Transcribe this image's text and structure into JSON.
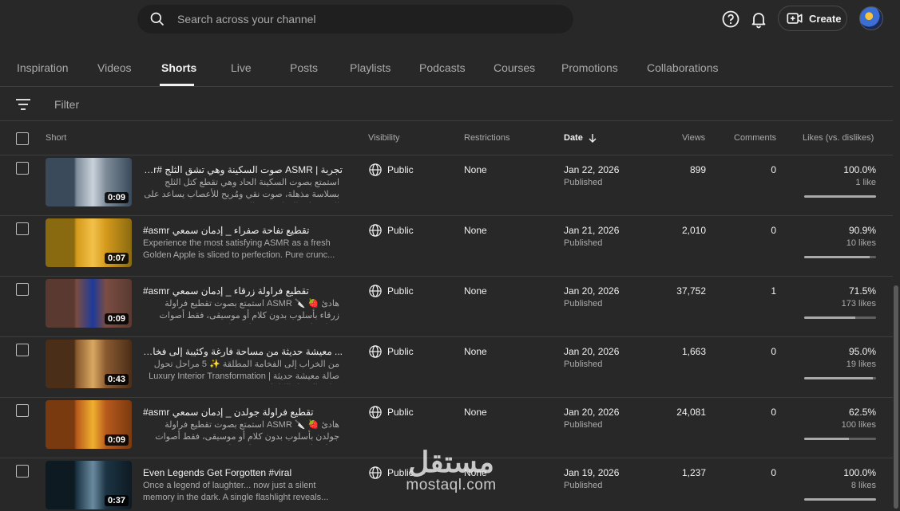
{
  "search": {
    "placeholder": "Search across your channel"
  },
  "header_actions": {
    "create_label": "Create"
  },
  "tabs": [
    {
      "label": "Inspiration"
    },
    {
      "label": "Videos"
    },
    {
      "label": "Shorts"
    },
    {
      "label": "Live"
    },
    {
      "label": "Posts"
    },
    {
      "label": "Playlists"
    },
    {
      "label": "Podcasts"
    },
    {
      "label": "Courses"
    },
    {
      "label": "Promotions"
    },
    {
      "label": "Collaborations"
    }
  ],
  "active_tab": "Shorts",
  "filter": {
    "placeholder": "Filter"
  },
  "columns": {
    "short": "Short",
    "visibility": "Visibility",
    "restrictions": "Restrictions",
    "date": "Date",
    "views": "Views",
    "comments": "Comments",
    "likes": "Likes (vs. dislikes)"
  },
  "rows": [
    {
      "duration": "0:09",
      "title": "تجربة | ASMR صوت السكينة وهي تشق الثلج #asmr نقية",
      "description": "استمتع بصوت السكينة الحاد وهي تقطع كتل الثلج بسلاسة مذهلة، صوت نقي ومُريح للأعصاب يساعد على الاسترخاء والتخلص من التوتر...",
      "visibility": "Public",
      "restrictions": "None",
      "date": "Jan 22, 2026",
      "status": "Published",
      "views": "899",
      "comments": "0",
      "likes_pct": "100.0%",
      "likes_count": "1 like",
      "likes_ratio": 1.0,
      "thumb_colors": [
        "#3a4a5a",
        "#7e8c9a",
        "#c9d2da"
      ]
    },
    {
      "duration": "0:07",
      "title": "#asmr تقطيع تفاحة صفراء _ إدمان سمعي",
      "description": "Experience the most satisfying ASMR as a fresh Golden Apple is sliced to perfection. Pure crunc...",
      "visibility": "Public",
      "restrictions": "None",
      "date": "Jan 21, 2026",
      "status": "Published",
      "views": "2,010",
      "comments": "0",
      "likes_pct": "90.9%",
      "likes_count": "10 likes",
      "likes_ratio": 0.909,
      "thumb_colors": [
        "#8a6a10",
        "#d49a1c",
        "#f2c14a"
      ]
    },
    {
      "duration": "0:09",
      "title": "#asmr تقطيع فراولة زرقاء _ إدمان سمعي",
      "description": "هادئ 🍓 🔪 ASMR استمتع بصوت تقطيع فراولة زرقاء بأسلوب بدون كلام أو موسيقى، فقط أصوات تقطيع ناعمة ومُرضية تساعد على...",
      "visibility": "Public",
      "restrictions": "None",
      "date": "Jan 20, 2026",
      "status": "Published",
      "views": "37,752",
      "comments": "1",
      "likes_pct": "71.5%",
      "likes_count": "173 likes",
      "likes_ratio": 0.715,
      "thumb_colors": [
        "#5a3a30",
        "#7a4d42",
        "#1e3a9a"
      ]
    },
    {
      "duration": "0:43",
      "title": "... معيشة حديثة من مساحة فارغة وكئيبة إلى فخامة عصرية مطلقة",
      "description": "من الخراب إلى الفخامة المطلقة ✨ 5 مراحل تحول صالة معيشة حديثة | Luxury Interior Transformation شاهد التحول الكامل...",
      "visibility": "Public",
      "restrictions": "None",
      "date": "Jan 20, 2026",
      "status": "Published",
      "views": "1,663",
      "comments": "0",
      "likes_pct": "95.0%",
      "likes_count": "19 likes",
      "likes_ratio": 0.95,
      "thumb_colors": [
        "#4a2e18",
        "#8a5a30",
        "#d9a860"
      ]
    },
    {
      "duration": "0:09",
      "title": "#asmr تقطيع فراولة جولدن _ إدمان سمعي",
      "description": "هادئ 🍓 🔪 ASMR استمتع بصوت تقطيع فراولة جولدن بأسلوب بدون كلام أو موسيقى، فقط أصوات تقطيع ناعمة ومُرضية تساعد على...",
      "visibility": "Public",
      "restrictions": "None",
      "date": "Jan 20, 2026",
      "status": "Published",
      "views": "24,081",
      "comments": "0",
      "likes_pct": "62.5%",
      "likes_count": "100 likes",
      "likes_ratio": 0.625,
      "thumb_colors": [
        "#7a3a10",
        "#b85a1c",
        "#f0b030"
      ]
    },
    {
      "duration": "0:37",
      "title": "Even Legends Get Forgotten #viral",
      "description": "Once a legend of laughter... now just a silent memory in the dark. A single flashlight reveals...",
      "visibility": "Public",
      "restrictions": "None",
      "date": "Jan 19, 2026",
      "status": "Published",
      "views": "1,237",
      "comments": "0",
      "likes_pct": "100.0%",
      "likes_count": "8 likes",
      "likes_ratio": 1.0,
      "thumb_colors": [
        "#0e1a22",
        "#1c3444",
        "#6a8aa0"
      ]
    }
  ],
  "watermark": {
    "arabic": "مستقل",
    "latin": "mostaql.com"
  }
}
